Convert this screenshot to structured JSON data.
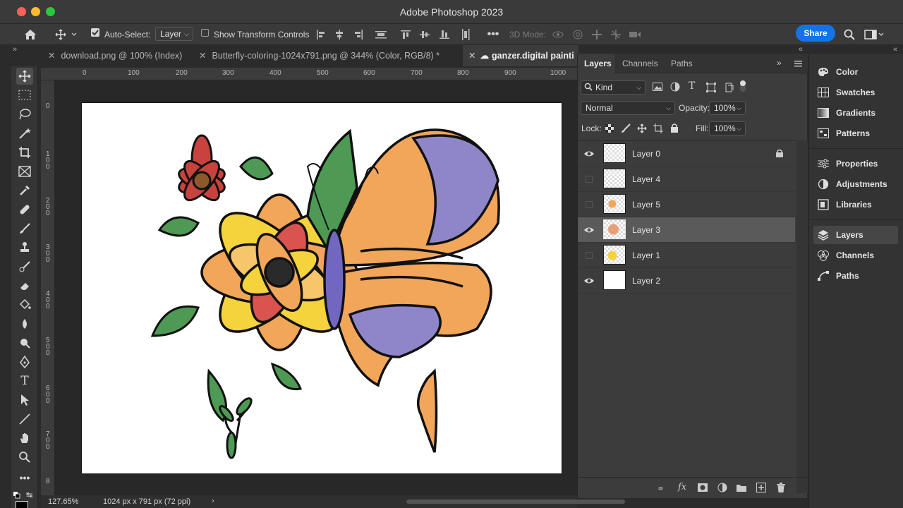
{
  "app": {
    "title": "Adobe Photoshop 2023"
  },
  "options": {
    "auto_select_label": "Auto-Select:",
    "auto_select_checked": true,
    "auto_select_target": "Layer",
    "show_transform_label": "Show Transform Controls",
    "show_transform_checked": false,
    "mode_3d_label": "3D Mode:",
    "share_label": "Share"
  },
  "doc_tabs": [
    {
      "label": "download.png @ 100% (Index)",
      "active": false
    },
    {
      "label": "Butterfly-coloring-1024x791.png @ 344% (Color, RGB/8) *",
      "active": false
    },
    {
      "label": "ganzer.digital painti",
      "active": true
    }
  ],
  "ruler": {
    "h_ticks": [
      "0",
      "100",
      "200",
      "300",
      "400",
      "500",
      "600",
      "700",
      "800",
      "900",
      "1000"
    ],
    "v_ticks": [
      "0",
      "1\n0\n0",
      "2\n0\n0",
      "3\n0\n0",
      "4\n0\n0",
      "5\n0\n0",
      "6\n0\n0",
      "7\n0\n0",
      "8"
    ]
  },
  "status": {
    "zoom": "127.65%",
    "doc_size": "1024 px x 791 px (72 ppi)"
  },
  "layers_panel": {
    "tabs": [
      "Layers",
      "Channels",
      "Paths"
    ],
    "active_tab": "Layers",
    "filter_kind": "Kind",
    "blend_mode": "Normal",
    "opacity_label": "Opacity:",
    "opacity_value": "100%",
    "lock_label": "Lock:",
    "fill_label": "Fill:",
    "fill_value": "100%",
    "layers": [
      {
        "name": "Layer 0",
        "visible": true,
        "locked": true,
        "selected": false
      },
      {
        "name": "Layer 4",
        "visible": false,
        "locked": false,
        "selected": false
      },
      {
        "name": "Layer 5",
        "visible": false,
        "locked": false,
        "selected": false
      },
      {
        "name": "Layer 3",
        "visible": true,
        "locked": false,
        "selected": true
      },
      {
        "name": "Layer 1",
        "visible": false,
        "locked": false,
        "selected": false
      },
      {
        "name": "Layer 2",
        "visible": true,
        "locked": false,
        "selected": false
      }
    ]
  },
  "right_dock": {
    "group1": [
      "Color",
      "Swatches",
      "Gradients",
      "Patterns"
    ],
    "group2": [
      "Properties",
      "Adjustments",
      "Libraries"
    ],
    "group3": [
      "Layers",
      "Channels",
      "Paths"
    ],
    "active": "Layers"
  },
  "colors": {
    "accent": "#1473e6",
    "panel": "#3c3c3c",
    "selected_row": "#5a5a5a"
  }
}
